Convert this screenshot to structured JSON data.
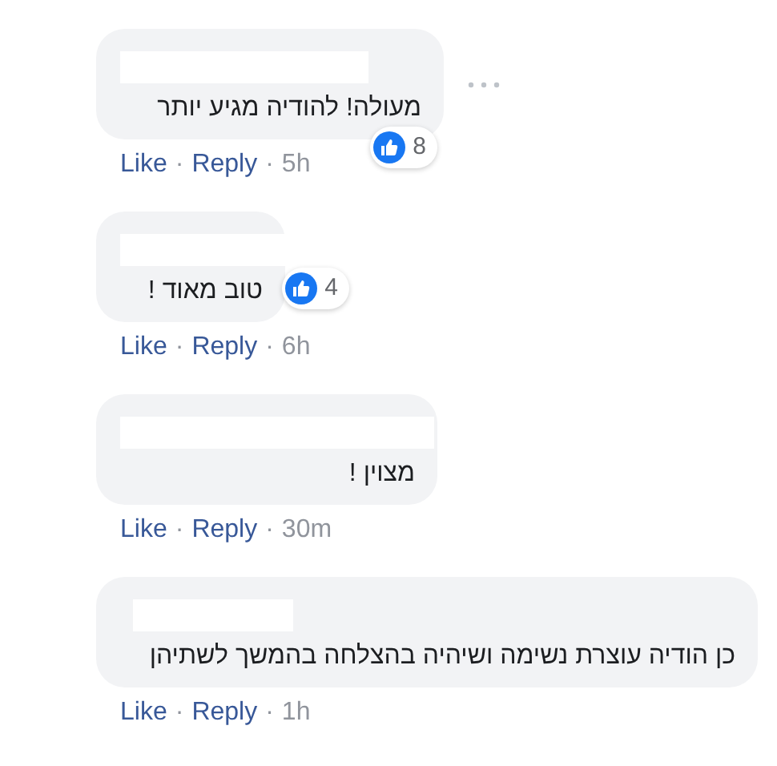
{
  "comments": [
    {
      "text": "מעולה! להודיה מגיע יותר",
      "reaction_count": "8",
      "more_menu": true,
      "like_link": "Like",
      "separator_1": "·",
      "reply_link": "Reply",
      "separator_2": "·",
      "time": "5h"
    },
    {
      "text": "טוב מאוד !",
      "reaction_count": "4",
      "more_menu": false,
      "like_link": "Like",
      "separator_1": "·",
      "reply_link": "Reply",
      "separator_2": "·",
      "time": "6h"
    },
    {
      "text": "מצוין !",
      "more_menu": false,
      "like_link": "Like",
      "separator_1": "·",
      "reply_link": "Reply",
      "separator_2": "·",
      "time": "30m"
    },
    {
      "text": "כן הודיה עוצרת נשימה ושיהיה בהצלחה בהמשך לשתיהן",
      "more_menu": false,
      "like_link": "Like",
      "separator_1": "·",
      "reply_link": "Reply",
      "separator_2": "·",
      "time": "1h"
    }
  ]
}
